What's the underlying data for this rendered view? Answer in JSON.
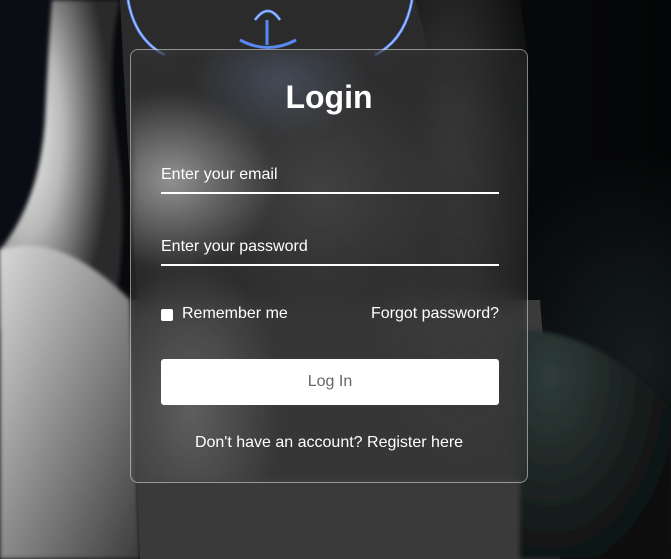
{
  "form": {
    "title": "Login",
    "email_placeholder": "Enter your email",
    "password_placeholder": "Enter your password",
    "remember_label": "Remember me",
    "forgot_link": "Forgot password?",
    "login_button": "Log In",
    "register_prompt": "Don't have an account?",
    "register_link": "Register here"
  },
  "colors": {
    "text": "#ffffff",
    "button_bg": "#ffffff",
    "button_text": "#666666",
    "mask_glow": "#5a8dff"
  }
}
